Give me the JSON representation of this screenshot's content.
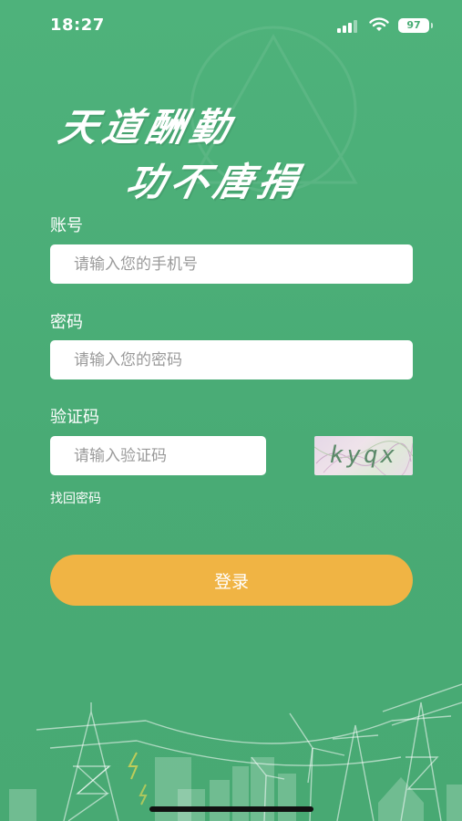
{
  "status_bar": {
    "time": "18:27",
    "battery": "97",
    "signal_icon": "cellular-signal-icon",
    "wifi_icon": "wifi-icon"
  },
  "slogan": {
    "line1": "天道酬勤",
    "line2": "功不唐捐"
  },
  "form": {
    "account": {
      "label": "账号",
      "placeholder": "请输入您的手机号",
      "value": ""
    },
    "password": {
      "label": "密码",
      "placeholder": "请输入您的密码",
      "value": ""
    },
    "captcha": {
      "label": "验证码",
      "placeholder": "请输入验证码",
      "value": "",
      "image_text": "kyqx"
    },
    "forgot_password": "找回密码",
    "login_button": "登录"
  },
  "colors": {
    "background": "#4aad76",
    "button": "#f0b444",
    "text": "#ffffff"
  }
}
